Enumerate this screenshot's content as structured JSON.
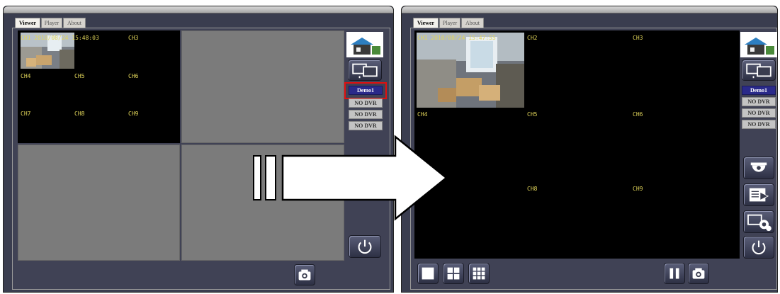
{
  "left_window": {
    "tabs": [
      "Viewer",
      "Player",
      "About"
    ],
    "channels": [
      "CH1",
      "CH3",
      "CH4",
      "CH5",
      "CH6",
      "CH7",
      "CH8",
      "CH9"
    ],
    "timestamp": "2010/08/24 15:48:03",
    "dvr_buttons": [
      "Demo1",
      "NO DVR",
      "NO DVR",
      "NO DVR"
    ],
    "selected_dvr": "Demo1"
  },
  "right_window": {
    "tabs": [
      "Viewer",
      "Player",
      "About"
    ],
    "channels": [
      "CH1",
      "CH2",
      "CH3",
      "CH4",
      "CH5",
      "CH6",
      "CH8",
      "CH9"
    ],
    "timestamp": "2010/08/24 15:47:55",
    "dvr_buttons": [
      "Demo1",
      "NO DVR",
      "NO DVR",
      "NO DVR"
    ],
    "selected_dvr": "Demo1"
  },
  "icons": {
    "logo": "house-logo-icon",
    "dvr_list": "monitors-icon",
    "dome_camera": "dome-camera-icon",
    "playback": "playback-icon",
    "settings": "settings-icon",
    "power": "power-icon",
    "snapshot": "camera-icon",
    "layout_1": "single-view-icon",
    "layout_4": "quad-view-icon",
    "layout_9": "nine-view-icon",
    "pause": "pause-icon",
    "arrow": "right-arrow-icon"
  },
  "colors": {
    "channel_label": "#e2d65a",
    "highlight_box": "#e01010",
    "selected_dvr": "#2a2a8a",
    "window_bg": "#3a3d4f"
  }
}
